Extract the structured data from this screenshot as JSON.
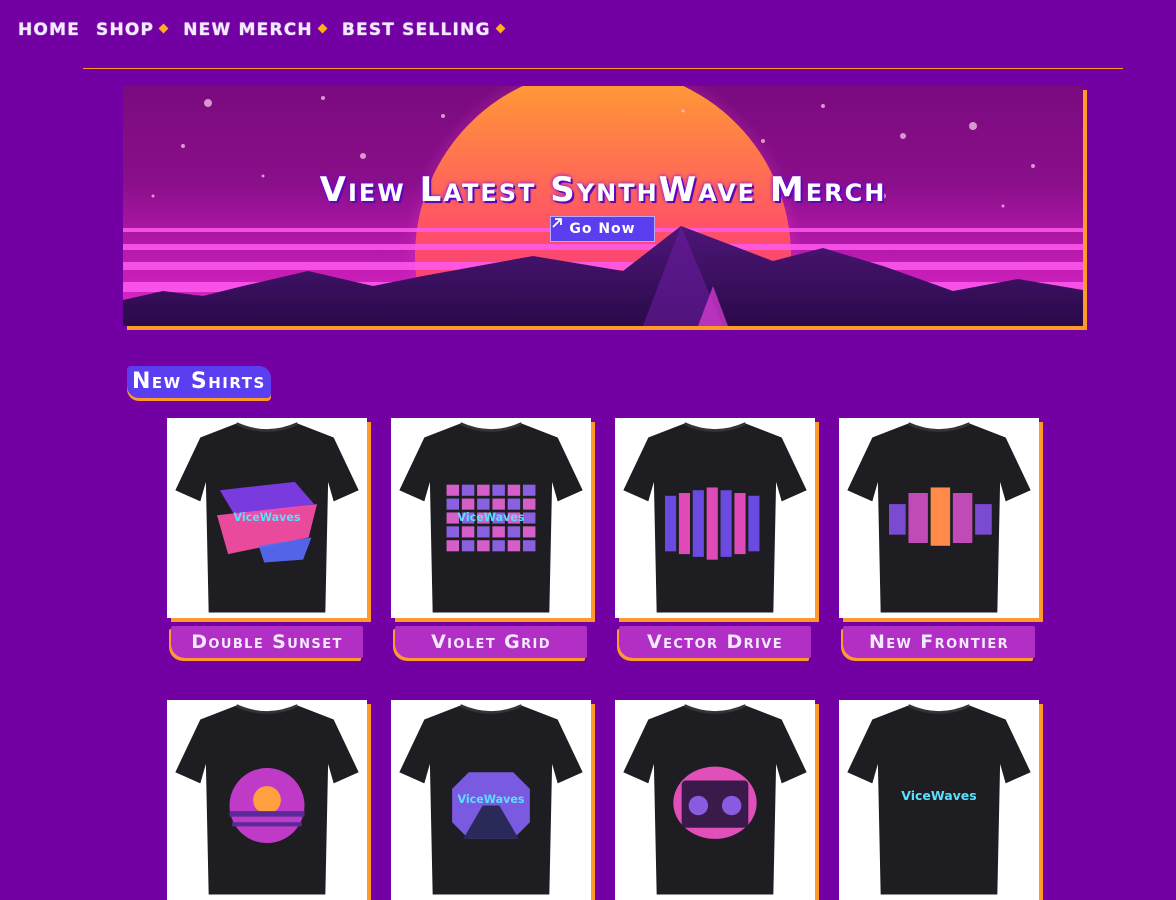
{
  "nav": {
    "items": [
      {
        "label": "HOME",
        "has_dropdown": false
      },
      {
        "label": "SHOP",
        "has_dropdown": true
      },
      {
        "label": "NEW MERCH",
        "has_dropdown": true
      },
      {
        "label": "BEST SELLING",
        "has_dropdown": true
      }
    ]
  },
  "banner": {
    "title": "View Latest SynthWave Merch",
    "button_label": "Go Now"
  },
  "section": {
    "title": "New Shirts"
  },
  "products": [
    {
      "name": "Double Sunset",
      "print_text": "ViceWaves",
      "design": "diagonal-panels"
    },
    {
      "name": "Violet Grid",
      "print_text": "ViceWaves",
      "design": "tile-grid"
    },
    {
      "name": "Vector Drive",
      "print_text": "",
      "design": "corridor"
    },
    {
      "name": "New Frontier",
      "print_text": "",
      "design": "split-panels"
    },
    {
      "name": "",
      "print_text": "",
      "design": "round-sunset"
    },
    {
      "name": "",
      "print_text": "ViceWaves",
      "design": "octagon-road"
    },
    {
      "name": "",
      "print_text": "",
      "design": "boombox"
    },
    {
      "name": "",
      "print_text": "ViceWaves",
      "design": "text-logo"
    }
  ],
  "colors": {
    "background": "#7300a3",
    "accent": "#ff9a2a",
    "button": "#5b3ef0",
    "card_title": "#b12fc4"
  }
}
